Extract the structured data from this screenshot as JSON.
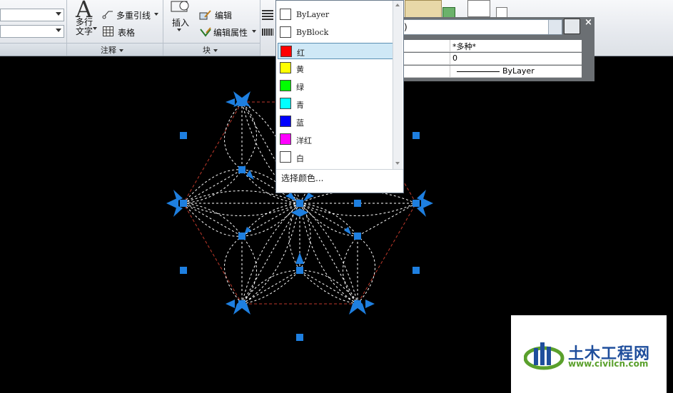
{
  "ribbon": {
    "annotation_panel": "注释",
    "block_panel": "块",
    "mtext_label_line1": "多行",
    "mtext_label_line2": "文字",
    "multileader": "多重引线",
    "table": "表格",
    "insert": "插入",
    "edit": "编辑",
    "edit_attributes": "编辑属性"
  },
  "color_dropdown": {
    "items": [
      {
        "label": "ByLayer",
        "color": "#ffffff"
      },
      {
        "label": "ByBlock",
        "color": "#ffffff"
      },
      {
        "label": "红",
        "color": "#ff0000"
      },
      {
        "label": "黄",
        "color": "#ffff00"
      },
      {
        "label": "绿",
        "color": "#00ff00"
      },
      {
        "label": "青",
        "color": "#00ffff"
      },
      {
        "label": "蓝",
        "color": "#0000ff"
      },
      {
        "label": "洋红",
        "color": "#ff00ff"
      },
      {
        "label": "白",
        "color": "#ffffff"
      }
    ],
    "selected": "红",
    "select_color": "选择颜色..."
  },
  "properties": {
    "combo_text": ")",
    "rows": [
      {
        "value": "*多种*"
      },
      {
        "value": "0"
      },
      {
        "value": "ByLayer"
      }
    ]
  },
  "logo": {
    "cn": "土木工程网",
    "url": "www.civilcn.com"
  },
  "colors": {
    "canvas": "#000000",
    "grip": "#1e7fe0",
    "hexagon": "#c0392b",
    "petals": "#ffffff",
    "logo_blue": "#1f4e9c",
    "logo_green": "#5aa02c"
  }
}
